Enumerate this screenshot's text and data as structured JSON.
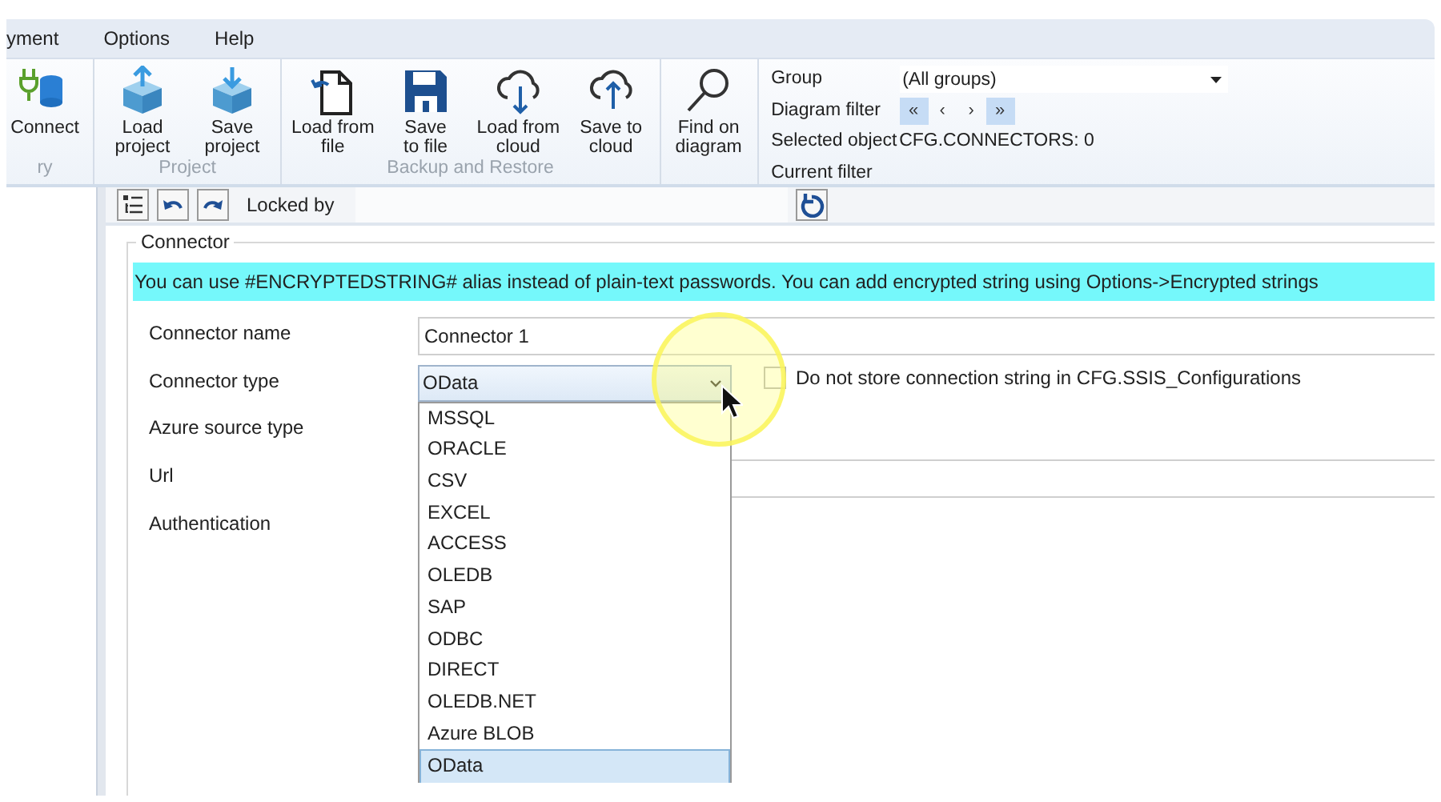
{
  "menu": [
    {
      "label": "yment"
    },
    {
      "label": "Options"
    },
    {
      "label": "Help"
    }
  ],
  "ribbon": {
    "groups": [
      {
        "label": "ry",
        "buttons": [
          {
            "label": "Connect",
            "kind": "plug"
          }
        ]
      },
      {
        "label": "Project",
        "buttons": [
          {
            "label": "Load\nproject",
            "kind": "box-up"
          },
          {
            "label": "Save\nproject",
            "kind": "box-down"
          }
        ]
      },
      {
        "label": "Backup and Restore",
        "buttons": [
          {
            "label": "Load from\nfile",
            "kind": "file"
          },
          {
            "label": "Save\nto file",
            "kind": "floppy"
          },
          {
            "label": "Load from\ncloud",
            "kind": "cloud-down"
          },
          {
            "label": "Save to\ncloud",
            "kind": "cloud-up"
          }
        ]
      },
      {
        "buttons": [
          {
            "label": "Find on\ndiagram",
            "kind": "magnifier"
          }
        ]
      }
    ],
    "filter": {
      "group_label": "Group",
      "group_value": "(All groups)",
      "diagram_filter_label": "Diagram filter",
      "nav_buttons": [
        {
          "label": "«",
          "highlighted": true
        },
        {
          "label": "‹",
          "highlighted": false
        },
        {
          "label": "›",
          "highlighted": false
        },
        {
          "label": "»",
          "highlighted": true
        }
      ],
      "selected_object_label": "Selected object",
      "selected_object_value": "CFG.CONNECTORS: 0",
      "current_filter_label": "Current filter"
    }
  },
  "toolbar": {
    "locked_by_label": "Locked by"
  },
  "form": {
    "title": "Connector",
    "banner": "You can use #ENCRYPTEDSTRING# alias instead of plain-text passwords. You can add encrypted string using Options->Encrypted strings",
    "fields": [
      {
        "label": "Connector name",
        "kind": "text",
        "value": "Connector 1"
      },
      {
        "label": "Connector type",
        "kind": "combo",
        "value": "OData",
        "expanded": true,
        "options": [
          {
            "label": "MSSQL",
            "selected": false
          },
          {
            "label": "ORACLE",
            "selected": false
          },
          {
            "label": "CSV",
            "selected": false
          },
          {
            "label": "EXCEL",
            "selected": false
          },
          {
            "label": "ACCESS",
            "selected": false
          },
          {
            "label": "OLEDB",
            "selected": false
          },
          {
            "label": "SAP",
            "selected": false
          },
          {
            "label": "ODBC",
            "selected": false
          },
          {
            "label": "DIRECT",
            "selected": false
          },
          {
            "label": "OLEDB.NET",
            "selected": false
          },
          {
            "label": "Azure BLOB",
            "selected": false
          },
          {
            "label": "OData",
            "selected": true
          }
        ],
        "checkbox": {
          "label": "Do not store connection string in CFG.SSIS_Configurations",
          "checked": false
        }
      },
      {
        "label": "Azure source type",
        "kind": "blank"
      },
      {
        "label": "Url",
        "kind": "text"
      },
      {
        "label": "Authentication",
        "kind": "blank"
      }
    ]
  }
}
